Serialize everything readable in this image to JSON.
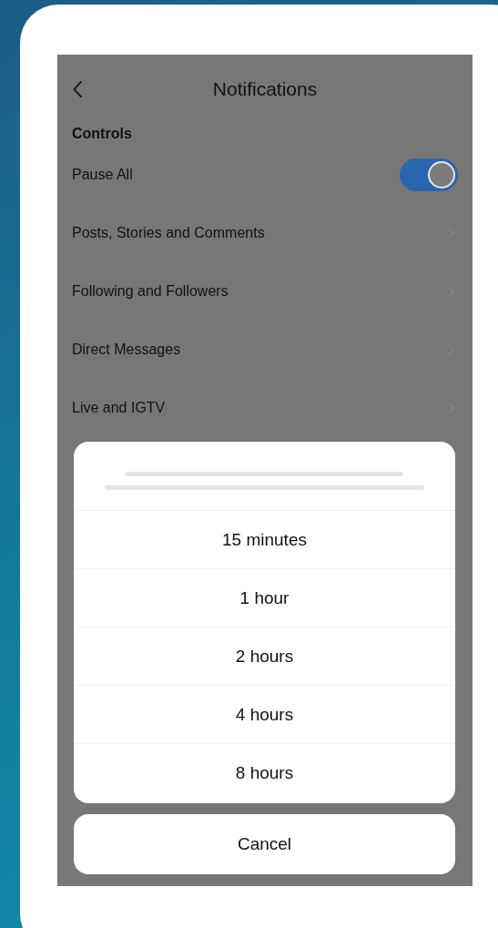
{
  "header": {
    "title": "Notifications"
  },
  "section_title": "Controls",
  "settings": [
    {
      "kind": "toggle",
      "label": "Pause All",
      "on": true
    },
    {
      "kind": "link",
      "label": "Posts, Stories and Comments"
    },
    {
      "kind": "link",
      "label": "Following and Followers"
    },
    {
      "kind": "link",
      "label": "Direct Messages"
    },
    {
      "kind": "link",
      "label": "Live and IGTV"
    }
  ],
  "action_sheet": {
    "options": [
      "15 minutes",
      "1 hour",
      "2 hours",
      "4 hours",
      "8 hours"
    ],
    "cancel": "Cancel"
  }
}
